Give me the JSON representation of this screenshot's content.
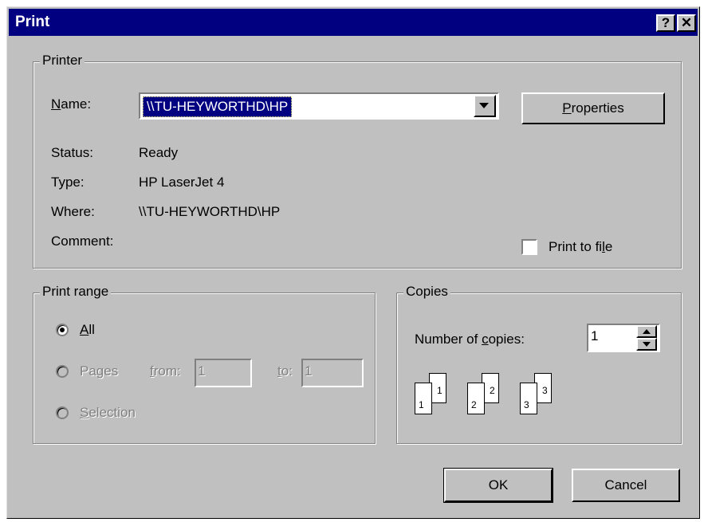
{
  "window": {
    "title": "Print",
    "help_label": "?",
    "close_label": "✕"
  },
  "printer": {
    "group_label": "Printer",
    "name_label": "Name:",
    "name_mnemonic": "N",
    "name_rest": "ame:",
    "name_value": "\\\\TU-HEYWORTHD\\HP",
    "properties_label": "Properties",
    "properties_mnemonic": "P",
    "properties_rest": "roperties",
    "status_label": "Status:",
    "status_value": "Ready",
    "type_label": "Type:",
    "type_value": "HP LaserJet 4",
    "where_label": "Where:",
    "where_value": "\\\\TU-HEYWORTHD\\HP",
    "comment_label": "Comment:",
    "print_to_file_label": "Print to file",
    "print_to_file_prefix": "Print to fi",
    "print_to_file_mnemonic": "l",
    "print_to_file_suffix": "e",
    "print_to_file_checked": false
  },
  "print_range": {
    "group_label": "Print range",
    "all_mnemonic": "A",
    "all_rest": "ll",
    "pages_prefix": "Pa",
    "pages_mnemonic": "g",
    "pages_suffix": "es",
    "from_mnemonic": "f",
    "from_rest": "rom:",
    "from_value": "1",
    "to_mnemonic": "t",
    "to_rest": "o:",
    "to_value": "1",
    "selection_mnemonic": "S",
    "selection_rest": "election",
    "selected": "All"
  },
  "copies": {
    "group_label": "Copies",
    "number_prefix": "Number of ",
    "number_mnemonic": "c",
    "number_suffix": "opies:",
    "number_value": "1",
    "collate_pages": [
      "1",
      "1",
      "2",
      "2",
      "3",
      "3"
    ]
  },
  "buttons": {
    "ok_label": "OK",
    "cancel_label": "Cancel"
  },
  "icons": {
    "dropdown": "triangle-down",
    "spin_up": "triangle-up",
    "spin_down": "triangle-down"
  }
}
